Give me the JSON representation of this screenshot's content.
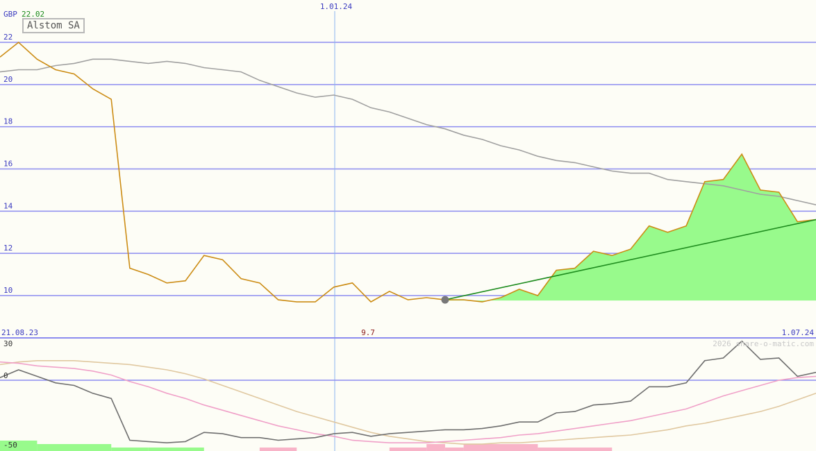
{
  "chart_data": [
    {
      "type": "line",
      "title": "Alstom SA",
      "currency": "GBP",
      "last_price": "22.02",
      "low_marker": "9.7",
      "date_labels": [
        "21.08.23",
        "1.01.24",
        "1.07.24"
      ],
      "ylim": [
        9.5,
        22.5
      ],
      "yticks": [
        10,
        12,
        14,
        16,
        18,
        20,
        22
      ],
      "grid": true,
      "x": [
        0,
        1,
        2,
        3,
        4,
        5,
        6,
        7,
        8,
        9,
        10,
        11,
        12,
        13,
        14,
        15,
        16,
        17,
        18,
        19,
        20,
        21,
        22,
        23,
        24,
        25,
        26,
        27,
        28,
        29,
        30,
        31,
        32,
        33,
        34,
        35,
        36,
        37,
        38,
        39,
        40,
        41,
        42,
        43,
        44
      ],
      "series": [
        {
          "values": [
            21.3,
            22.0,
            21.2,
            20.7,
            20.5,
            19.8,
            19.3,
            11.3,
            11.0,
            10.6,
            10.7,
            11.9,
            11.7,
            10.8,
            10.6,
            9.8,
            9.7,
            9.7,
            10.4,
            10.6,
            9.7,
            10.2,
            9.8,
            9.9,
            9.8,
            9.8,
            9.7,
            9.9,
            10.3,
            10.0,
            11.2,
            11.3,
            12.1,
            11.9,
            12.2,
            13.3,
            13.0,
            13.3,
            15.4,
            15.5,
            16.7,
            15.0,
            14.9,
            13.5,
            13.6
          ],
          "color": "#cc8c14"
        },
        {
          "values": [
            20.6,
            20.7,
            20.7,
            20.9,
            21.0,
            21.2,
            21.2,
            21.1,
            21.0,
            21.1,
            21.0,
            20.8,
            20.7,
            20.6,
            20.2,
            19.9,
            19.6,
            19.4,
            19.5,
            19.3,
            18.9,
            18.7,
            18.4,
            18.1,
            17.9,
            17.6,
            17.4,
            17.1,
            16.9,
            16.6,
            16.4,
            16.3,
            16.1,
            15.9,
            15.8,
            15.8,
            15.5,
            15.4,
            15.3,
            15.2,
            15.0,
            14.8,
            14.7,
            14.5,
            14.3
          ],
          "color": "#a0a0a0"
        }
      ],
      "trendline": {
        "from": [
          24,
          9.8
        ],
        "to": [
          44,
          13.6
        ],
        "color": "#1e8c1e"
      },
      "trend_marker": {
        "x": 24,
        "y": 9.8
      },
      "fill_color": "#98fa8c"
    },
    {
      "type": "line",
      "ylim": [
        -50,
        30
      ],
      "yticks": [
        30,
        0,
        -50
      ],
      "grid": true,
      "x": [
        0,
        1,
        2,
        3,
        4,
        5,
        6,
        7,
        8,
        9,
        10,
        11,
        12,
        13,
        14,
        15,
        16,
        17,
        18,
        19,
        20,
        21,
        22,
        23,
        24,
        25,
        26,
        27,
        28,
        29,
        30,
        31,
        32,
        33,
        34,
        35,
        36,
        37,
        38,
        39,
        40,
        41,
        42,
        43,
        44
      ],
      "series": [
        {
          "values": [
            2,
            8,
            3,
            -2,
            -4,
            -10,
            -14,
            -46,
            -47,
            -48,
            -47,
            -40,
            -41,
            -44,
            -44,
            -46,
            -45,
            -44,
            -41,
            -40,
            -43,
            -41,
            -40,
            -39,
            -38,
            -38,
            -37,
            -35,
            -32,
            -32,
            -25,
            -24,
            -19,
            -18,
            -16,
            -5,
            -5,
            -2,
            15,
            17,
            30,
            16,
            17,
            3,
            6
          ],
          "color": "#6e6e6e"
        },
        {
          "values": [
            14,
            13,
            11,
            10,
            9,
            7,
            4,
            -1,
            -5,
            -10,
            -14,
            -19,
            -23,
            -27,
            -31,
            -35,
            -38,
            -41,
            -43,
            -46,
            -47,
            -48,
            -48,
            -48,
            -47,
            -46,
            -45,
            -44,
            -42,
            -41,
            -39,
            -37,
            -35,
            -33,
            -31,
            -28,
            -25,
            -22,
            -17,
            -12,
            -8,
            -4,
            0,
            2,
            3
          ],
          "color": "#f0a0c8"
        },
        {
          "values": [
            12,
            14,
            15,
            15,
            15,
            14,
            13,
            12,
            10,
            8,
            5,
            1,
            -4,
            -9,
            -14,
            -19,
            -24,
            -28,
            -32,
            -36,
            -40,
            -43,
            -45,
            -47,
            -48,
            -49,
            -49,
            -48,
            -48,
            -47,
            -46,
            -45,
            -44,
            -43,
            -42,
            -40,
            -38,
            -35,
            -33,
            -30,
            -27,
            -24,
            -20,
            -15,
            -10
          ],
          "color": "#e0c8a0"
        }
      ],
      "histogram": [
        {
          "from": 0,
          "to": 2,
          "level": 3,
          "color": "#98fa8c"
        },
        {
          "from": 2,
          "to": 6,
          "level": 2,
          "color": "#98fa8c"
        },
        {
          "from": 6,
          "to": 8,
          "level": 1,
          "color": "#98fa8c"
        },
        {
          "from": 8,
          "to": 11,
          "level": 1,
          "color": "#98fa8c"
        },
        {
          "from": 14,
          "to": 16,
          "level": 1,
          "color": "#f8b4c8"
        },
        {
          "from": 21,
          "to": 23,
          "level": 1,
          "color": "#f8b4c8"
        },
        {
          "from": 23,
          "to": 24,
          "level": 2,
          "color": "#f8b4c8"
        },
        {
          "from": 24,
          "to": 25,
          "level": 1,
          "color": "#f8b4c8"
        },
        {
          "from": 25,
          "to": 29,
          "level": 2,
          "color": "#f8b4c8"
        },
        {
          "from": 29,
          "to": 33,
          "level": 1,
          "color": "#f8b4c8"
        }
      ]
    }
  ],
  "copyright": "2026 share-o-matic.com",
  "colors": {
    "grid": "#8c8cf0",
    "axis_text": "#3a3ac0",
    "vertical_marker": "#8cb4f0",
    "low_text": "#8a1a1a"
  }
}
